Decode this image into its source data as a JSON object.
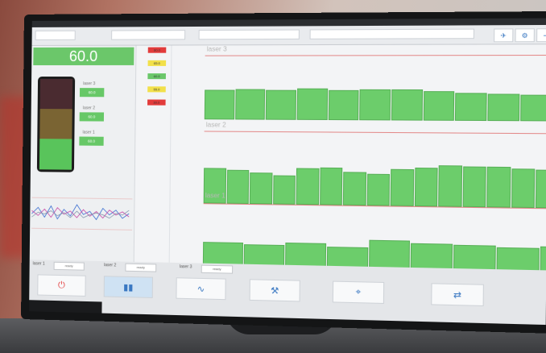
{
  "big_value": "60.0",
  "left_labels": [
    "laser 3",
    "laser 2",
    "laser 1"
  ],
  "left_pills": [
    "60.0",
    "60.0",
    "60.0"
  ],
  "side_badges": [
    {
      "text": "80.0",
      "color": "#e23b3b"
    },
    {
      "text": "65.0",
      "color": "#f2e04a"
    },
    {
      "text": "60.0",
      "color": "#6bc76a"
    },
    {
      "text": "55.0",
      "color": "#f2e04a"
    },
    {
      "text": "30.0",
      "color": "#e23b3b"
    }
  ],
  "sections": [
    {
      "title": "laser 3",
      "values": [
        0.6,
        0.62,
        0.6,
        0.63,
        0.6,
        0.61,
        0.61,
        0.59,
        0.55,
        0.53,
        0.52,
        0.54
      ]
    },
    {
      "title": "laser 2",
      "values": [
        0.62,
        0.58,
        0.55,
        0.5,
        0.63,
        0.64,
        0.57,
        0.54,
        0.63,
        0.66,
        0.7,
        0.69,
        0.68,
        0.66,
        0.64,
        0.6
      ]
    },
    {
      "title": "laser 1",
      "values": [
        0.58,
        0.56,
        0.6,
        0.54,
        0.67,
        0.63,
        0.61,
        0.59,
        0.62
      ]
    }
  ],
  "status_labels": [
    "laser 1",
    "laser 2",
    "laser 3"
  ],
  "status_values": [
    "ready",
    "ready",
    "ready"
  ],
  "nav_icons": [
    "power-icon",
    "bars-icon",
    "wave-icon",
    "tools-icon",
    "location-icon",
    "transfer-icon"
  ],
  "accent": "#6ccd6b",
  "warning": "#e23b3b"
}
